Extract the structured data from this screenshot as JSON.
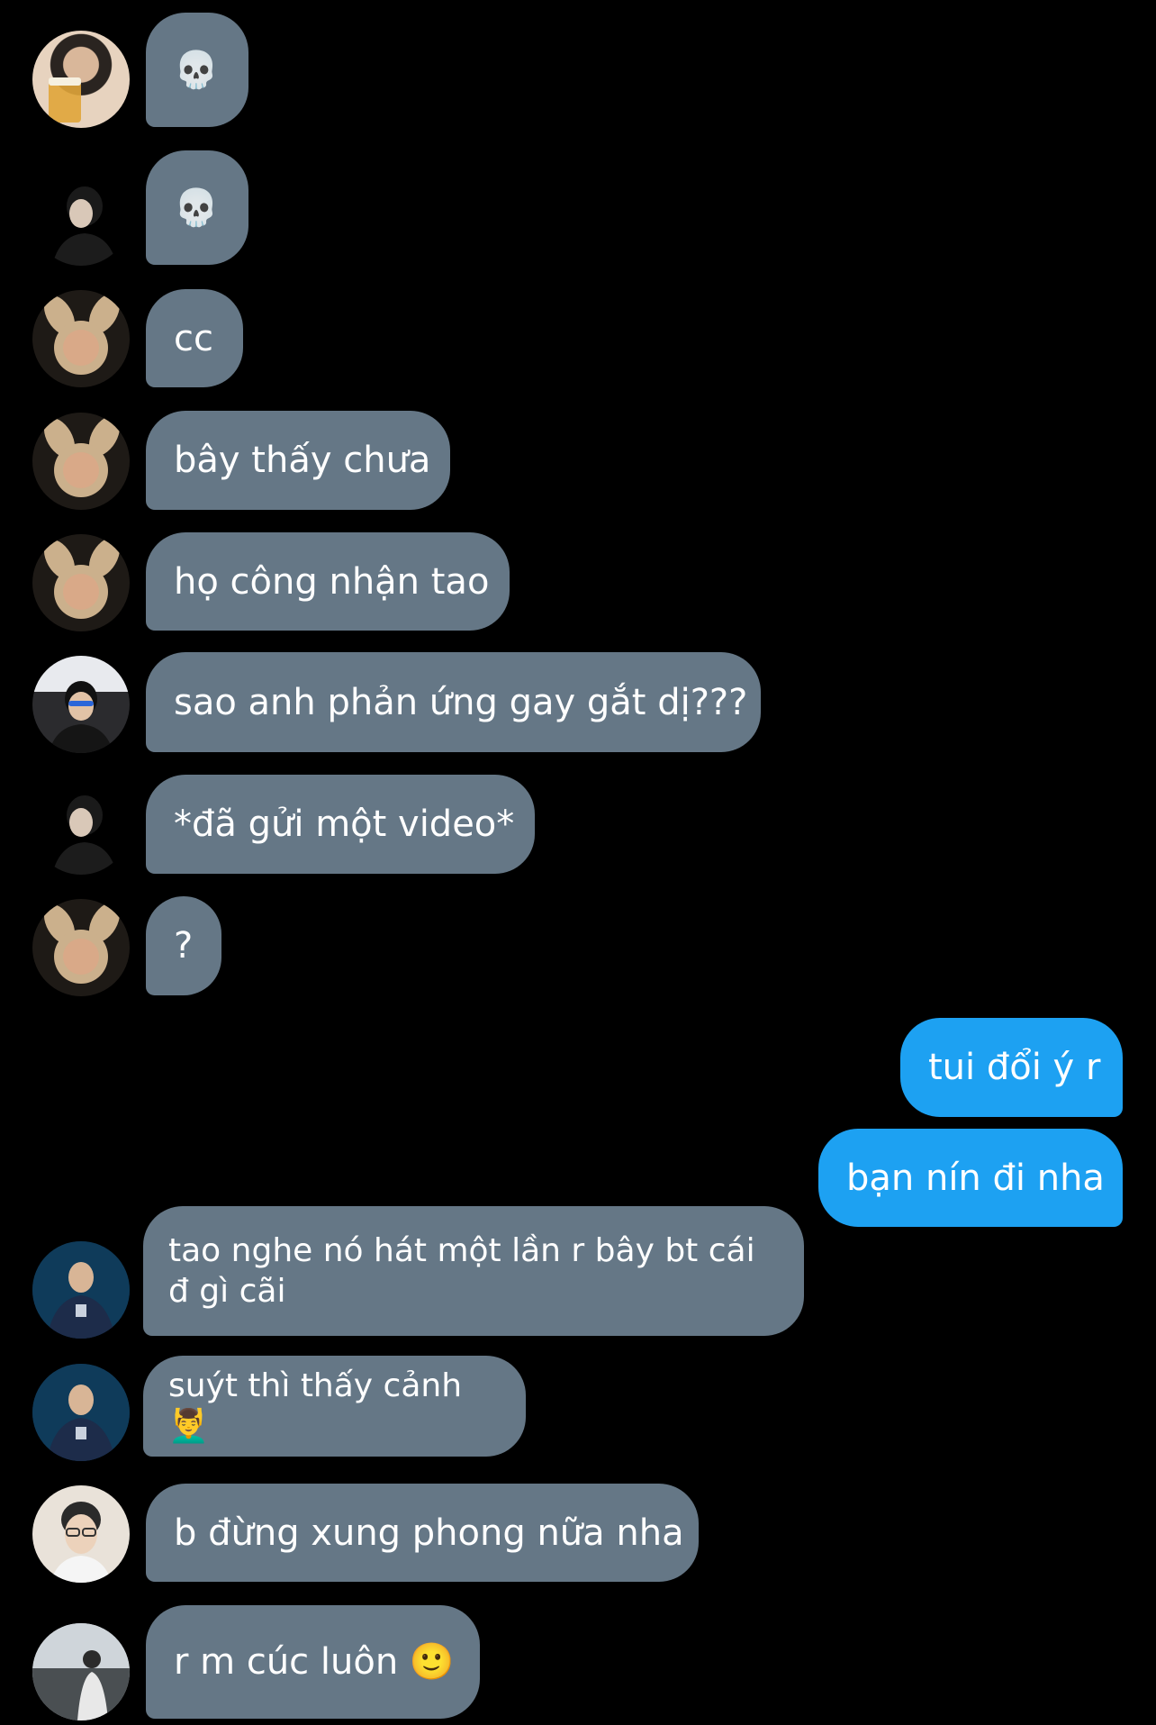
{
  "colors": {
    "background": "#000000",
    "incoming_bubble": "#657786",
    "outgoing_bubble": "#1da1f2",
    "text": "#ffffff"
  },
  "messages": [
    {
      "direction": "in",
      "avatar": "avatar-beer",
      "text": "💀"
    },
    {
      "direction": "in",
      "avatar": "avatar-glasses-profile",
      "text": "💀"
    },
    {
      "direction": "in",
      "avatar": "avatar-bunny-ears",
      "text": "cc"
    },
    {
      "direction": "in",
      "avatar": "avatar-bunny-ears",
      "text": "bây thấy chưa"
    },
    {
      "direction": "in",
      "avatar": "avatar-bunny-ears",
      "text": "họ công nhận tao"
    },
    {
      "direction": "in",
      "avatar": "avatar-headset",
      "text": "sao anh phản ứng gay gắt dị???"
    },
    {
      "direction": "in",
      "avatar": "avatar-glasses-profile",
      "text": "*đã gửi một video*"
    },
    {
      "direction": "in",
      "avatar": "avatar-bunny-ears",
      "text": "?"
    },
    {
      "direction": "out",
      "text": "tui đổi ý r"
    },
    {
      "direction": "out",
      "text": "bạn nín đi nha"
    },
    {
      "direction": "in",
      "avatar": "avatar-jersey",
      "text": "tao nghe nó hát một lần r bây bt cái đ gì cãi"
    },
    {
      "direction": "in",
      "avatar": "avatar-jersey",
      "text": "suýt thì thấy cảnh 💆‍♂️"
    },
    {
      "direction": "in",
      "avatar": "avatar-smile",
      "text": "b đừng xung phong nữa nha"
    },
    {
      "direction": "in",
      "avatar": "avatar-outdoor",
      "text": "r m cúc luôn 🙂"
    }
  ]
}
